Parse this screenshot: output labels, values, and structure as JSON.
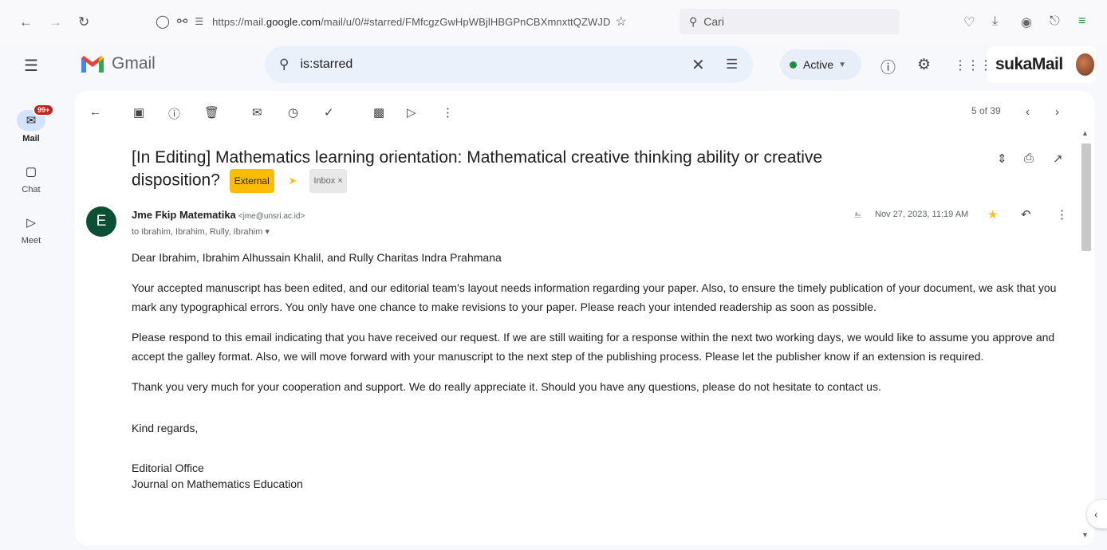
{
  "browser": {
    "url_prefix": "https://mail.",
    "url_domain": "google.com",
    "url_rest": "/mail/u/0/#starred/FMfcgzGwHpWBjlHBGPnCBXmnxttQZWJD",
    "search_placeholder": "Cari"
  },
  "header": {
    "app_name": "Gmail",
    "search_query": "is:starred",
    "status": "Active",
    "brand_prefix": "suka",
    "brand_accent": "Mail"
  },
  "rail": {
    "badge": "99+",
    "items": [
      {
        "label": "Mail"
      },
      {
        "label": "Chat"
      },
      {
        "label": "Meet"
      }
    ]
  },
  "toolbar": {
    "pager": "5 of 39"
  },
  "email": {
    "subject": "[In Editing] Mathematics learning orientation: Mathematical creative thinking ability or creative disposition?",
    "labels": {
      "external": "External",
      "inbox": "Inbox ×"
    },
    "sender_initial": "E",
    "sender_name": "Jme Fkip Matematika",
    "sender_email": "<jme@unsri.ac.id>",
    "to": "to Ibrahim, Ibrahim, Rully, Ibrahim",
    "date": "Nov 27, 2023, 11:19 AM",
    "greeting": "Dear Ibrahim, Ibrahim Alhussain Khalil, and Rully Charitas Indra Prahmana",
    "paragraphs": [
      "Your accepted manuscript has been edited, and our editorial team's layout needs information regarding your paper. Also, to ensure the timely publication of your document, we ask that you mark any typographical errors. You only have one chance to make revisions to your paper. Please reach your intended readership as soon as possible.",
      "Please respond to this email indicating that you have received our request. If we are still waiting for a response within the next two working days, we would like to assume you approve and accept the galley format. Also, we will move forward with your manuscript to the next step of the publishing process. Please let the publisher know if an extension is required.",
      "Thank you very much for your cooperation and support. We do really appreciate it. Should you have any questions, please do not hesitate to contact us."
    ],
    "closing": "Kind regards,",
    "sig_line1": "Editorial Office",
    "sig_line2": "Journal on Mathematics Education"
  },
  "colors": {
    "accent_bg": "#eaf1fb",
    "external_label": "#fbbc04",
    "avatar_green": "#0b4f35",
    "active_green": "#1e8e3e",
    "badge_red": "#c5221f"
  }
}
